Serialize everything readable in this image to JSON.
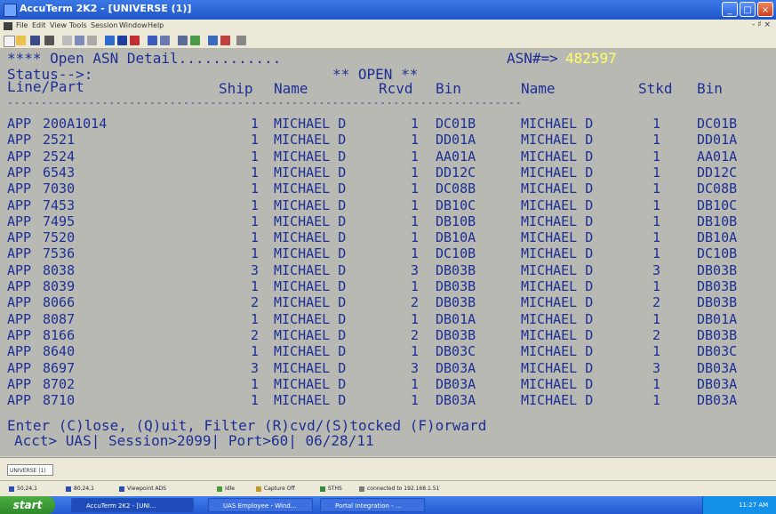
{
  "window": {
    "title": "AccuTerm 2K2 - [UNIVERSE (1)]",
    "buttons": {
      "minimize": "_",
      "maximize": "□",
      "close": "×"
    }
  },
  "menu": {
    "items": [
      "File",
      "Edit",
      "View",
      "Tools",
      "Session",
      "Window",
      "Help"
    ],
    "right": "- ♯ ×"
  },
  "terminal": {
    "header_left": "**** Open ASN Detail............",
    "asn_label": "ASN#=>",
    "asn_number": "482597",
    "status_label": "Status-->:",
    "open_label": "** OPEN **",
    "columns": {
      "line_part": "Line/Part",
      "ship": "Ship",
      "name1": "Name",
      "rcvd": "Rcvd",
      "bin1": "Bin",
      "name2": "Name",
      "stkd": "Stkd",
      "bin2": "Bin"
    },
    "separator": "----------------------------------------------------------------------------",
    "rows": [
      {
        "line": "APP",
        "part": "200A1014",
        "ship": "1",
        "name": "MICHAEL D",
        "rcvd": "1",
        "bin": "DC01B",
        "name2": "MICHAEL D",
        "stkd": "1",
        "bin2": "DC01B"
      },
      {
        "line": "APP",
        "part": "2521",
        "ship": "1",
        "name": "MICHAEL D",
        "rcvd": "1",
        "bin": "DD01A",
        "name2": "MICHAEL D",
        "stkd": "1",
        "bin2": "DD01A"
      },
      {
        "line": "APP",
        "part": "2524",
        "ship": "1",
        "name": "MICHAEL D",
        "rcvd": "1",
        "bin": "AA01A",
        "name2": "MICHAEL D",
        "stkd": "1",
        "bin2": "AA01A"
      },
      {
        "line": "APP",
        "part": "6543",
        "ship": "1",
        "name": "MICHAEL D",
        "rcvd": "1",
        "bin": "DD12C",
        "name2": "MICHAEL D",
        "stkd": "1",
        "bin2": "DD12C"
      },
      {
        "line": "APP",
        "part": "7030",
        "ship": "1",
        "name": "MICHAEL D",
        "rcvd": "1",
        "bin": "DC08B",
        "name2": "MICHAEL D",
        "stkd": "1",
        "bin2": "DC08B"
      },
      {
        "line": "APP",
        "part": "7453",
        "ship": "1",
        "name": "MICHAEL D",
        "rcvd": "1",
        "bin": "DB10C",
        "name2": "MICHAEL D",
        "stkd": "1",
        "bin2": "DB10C"
      },
      {
        "line": "APP",
        "part": "7495",
        "ship": "1",
        "name": "MICHAEL D",
        "rcvd": "1",
        "bin": "DB10B",
        "name2": "MICHAEL D",
        "stkd": "1",
        "bin2": "DB10B"
      },
      {
        "line": "APP",
        "part": "7520",
        "ship": "1",
        "name": "MICHAEL D",
        "rcvd": "1",
        "bin": "DB10A",
        "name2": "MICHAEL D",
        "stkd": "1",
        "bin2": "DB10A"
      },
      {
        "line": "APP",
        "part": "7536",
        "ship": "1",
        "name": "MICHAEL D",
        "rcvd": "1",
        "bin": "DC10B",
        "name2": "MICHAEL D",
        "stkd": "1",
        "bin2": "DC10B"
      },
      {
        "line": "APP",
        "part": "8038",
        "ship": "3",
        "name": "MICHAEL D",
        "rcvd": "3",
        "bin": "DB03B",
        "name2": "MICHAEL D",
        "stkd": "3",
        "bin2": "DB03B"
      },
      {
        "line": "APP",
        "part": "8039",
        "ship": "1",
        "name": "MICHAEL D",
        "rcvd": "1",
        "bin": "DB03B",
        "name2": "MICHAEL D",
        "stkd": "1",
        "bin2": "DB03B"
      },
      {
        "line": "APP",
        "part": "8066",
        "ship": "2",
        "name": "MICHAEL D",
        "rcvd": "2",
        "bin": "DB03B",
        "name2": "MICHAEL D",
        "stkd": "2",
        "bin2": "DB03B"
      },
      {
        "line": "APP",
        "part": "8087",
        "ship": "1",
        "name": "MICHAEL D",
        "rcvd": "1",
        "bin": "DB01A",
        "name2": "MICHAEL D",
        "stkd": "1",
        "bin2": "DB01A"
      },
      {
        "line": "APP",
        "part": "8166",
        "ship": "2",
        "name": "MICHAEL D",
        "rcvd": "2",
        "bin": "DB03B",
        "name2": "MICHAEL D",
        "stkd": "2",
        "bin2": "DB03B"
      },
      {
        "line": "APP",
        "part": "8640",
        "ship": "1",
        "name": "MICHAEL D",
        "rcvd": "1",
        "bin": "DB03C",
        "name2": "MICHAEL D",
        "stkd": "1",
        "bin2": "DB03C"
      },
      {
        "line": "APP",
        "part": "8697",
        "ship": "3",
        "name": "MICHAEL D",
        "rcvd": "3",
        "bin": "DB03A",
        "name2": "MICHAEL D",
        "stkd": "3",
        "bin2": "DB03A"
      },
      {
        "line": "APP",
        "part": "8702",
        "ship": "1",
        "name": "MICHAEL D",
        "rcvd": "1",
        "bin": "DB03A",
        "name2": "MICHAEL D",
        "stkd": "1",
        "bin2": "DB03A"
      },
      {
        "line": "APP",
        "part": "8710",
        "ship": "1",
        "name": "MICHAEL D",
        "rcvd": "1",
        "bin": "DB03A",
        "name2": "MICHAEL D",
        "stkd": "1",
        "bin2": "DB03A"
      }
    ],
    "prompt": "Enter (C)lose, (Q)uit, Filter (R)cvd/(S)tocked (F)orward",
    "info": "Acct> UAS| Session>2099| Port>60| 06/28/11"
  },
  "session_tab": "UNIVERSE (1)",
  "statusbar": {
    "items": [
      "50,24,1",
      "80,24,1",
      "Viewpoint ADS",
      "Idle",
      "Capture Off",
      "STHS",
      "connected to 192.168.1.51"
    ]
  },
  "taskbar": {
    "start": "start",
    "tasks": [
      "AccuTerm 2K2 - [UNI...",
      "UAS Employee - Wind...",
      "Portal Integration - ..."
    ],
    "clock": "11:27 AM"
  },
  "colors": {
    "terminal_bg": "#b9b9b3",
    "terminal_fg": "#1d2f94",
    "highlight": "#ffff66"
  }
}
